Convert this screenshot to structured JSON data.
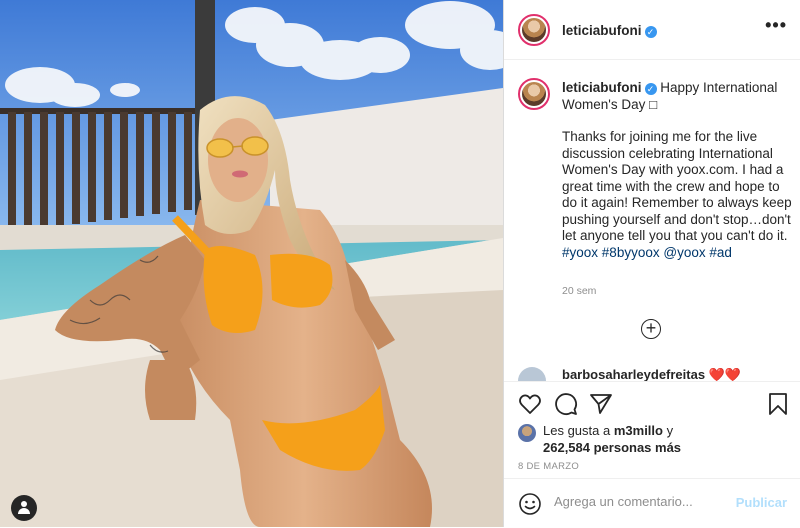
{
  "post": {
    "username": "leticiabufoni",
    "more_icon": "more-horizontal-icon",
    "caption_title": "Happy International Women's Day □",
    "caption_body": "Thanks for joining me for the live discussion celebrating International Women's Day with yoox.com. I had a great time with the crew and hope to do it again! Remember to always keep pushing yourself and don't stop…don't let anyone tell you that you can't do it.",
    "hashtags": [
      "#yoox",
      "#8byyoox"
    ],
    "mention": "@yoox",
    "hashtag_last": "#ad",
    "time_ago": "20 sem",
    "load_more_icon": "plus-circle-icon",
    "partial_comment": "barbosaharleydefreitas ❤️❤️"
  },
  "actions": {
    "icons": [
      "heart-icon",
      "comment-icon",
      "share-icon",
      "bookmark-icon"
    ],
    "likes_prefix": "Les gusta a",
    "liked_by": "m3millo",
    "likes_and": "y",
    "likes_count": "262,584 personas más",
    "date": "8 DE MARZO",
    "comment_placeholder": "Agrega un comentario...",
    "publish_label": "Publicar"
  },
  "colors": {
    "accent_blue": "#3897f0",
    "publish_disabled": "#b2dffc",
    "sky": "#5b92dc",
    "bikini": "#f5a01a"
  }
}
